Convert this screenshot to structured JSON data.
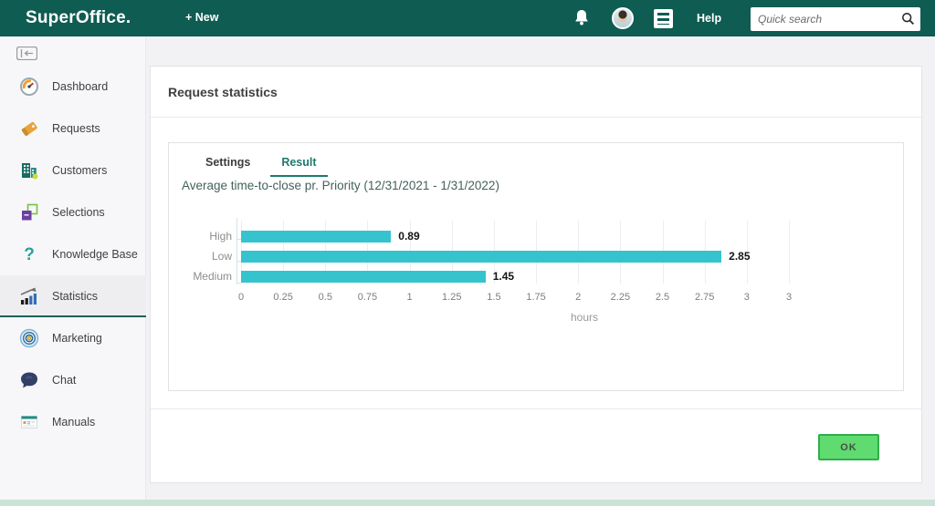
{
  "header": {
    "logo": "SuperOffice.",
    "new_label": "+ New",
    "help_label": "Help",
    "search_placeholder": "Quick search",
    "bar_color": "#0e5c52"
  },
  "sidebar": {
    "items": [
      {
        "label": "Dashboard",
        "icon": "gauge-icon",
        "active": false
      },
      {
        "label": "Requests",
        "icon": "tag-icon",
        "active": false
      },
      {
        "label": "Customers",
        "icon": "building-icon",
        "active": false
      },
      {
        "label": "Selections",
        "icon": "selection-squares-icon",
        "active": false
      },
      {
        "label": "Knowledge Base",
        "icon": "question-mark-icon",
        "active": false
      },
      {
        "label": "Statistics",
        "icon": "bar-chart-icon",
        "active": true
      },
      {
        "label": "Marketing",
        "icon": "target-icon",
        "active": false
      },
      {
        "label": "Chat",
        "icon": "speech-bubble-icon",
        "active": false
      },
      {
        "label": "Manuals",
        "icon": "document-icon",
        "active": false
      }
    ],
    "active_underline_color": "#11635a"
  },
  "main": {
    "page_title": "Request statistics",
    "tabs": [
      {
        "label": "Settings",
        "active": false
      },
      {
        "label": "Result",
        "active": true
      }
    ],
    "tab_active_color": "#1e7a6d",
    "ok_label": "OK",
    "ok_colors": {
      "fill": "#5fdb6f",
      "border": "#2fae4a"
    }
  },
  "chart_data": {
    "type": "bar",
    "orientation": "horizontal",
    "title": "Average time-to-close pr. Priority (12/31/2021 - 1/31/2022)",
    "categories": [
      "High",
      "Low",
      "Medium"
    ],
    "values": [
      0.89,
      2.85,
      1.45
    ],
    "value_labels": [
      "0.89",
      "2.85",
      "1.45"
    ],
    "xlabel": "hours",
    "ylabel": "",
    "xlim": [
      0,
      3.25
    ],
    "tick_step": 0.25,
    "x_tick_labels": [
      "0",
      "0.25",
      "0.5",
      "0.75",
      "1",
      "1.25",
      "1.5",
      "1.75",
      "2",
      "2.25",
      "2.5",
      "2.75",
      "3",
      "3"
    ],
    "grid": true,
    "legend": false,
    "bar_color": "#35c4cd"
  }
}
